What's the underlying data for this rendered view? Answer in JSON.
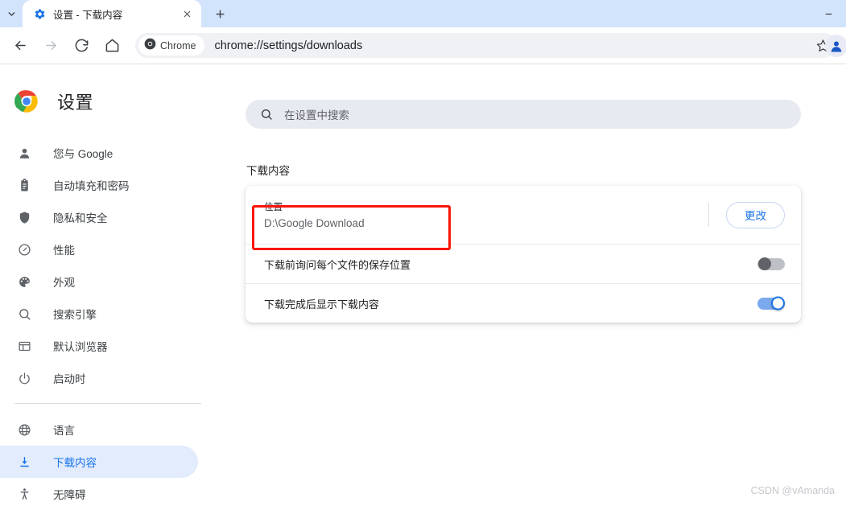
{
  "window": {
    "minimize_label": "−",
    "tab_list_icon": "chevron-down-icon"
  },
  "tab": {
    "favicon": "settings-gear-icon",
    "title": "设置 - 下载内容",
    "close_label": "✕",
    "newtab_label": "+"
  },
  "toolbar": {
    "back_icon": "back-arrow-icon",
    "forward_icon": "forward-arrow-icon",
    "reload_icon": "reload-icon",
    "home_icon": "home-icon",
    "chip_label": "Chrome",
    "url": "chrome://settings/downloads",
    "star_icon": "bookmark-star-icon",
    "profile_icon": "profile-avatar-icon"
  },
  "sidebar": {
    "brand_title": "设置",
    "brand_logo": "chrome-logo",
    "items": [
      {
        "label": "您与 Google",
        "icon": "person-icon",
        "selected": false
      },
      {
        "label": "自动填充和密码",
        "icon": "clipboard-icon",
        "selected": false
      },
      {
        "label": "隐私和安全",
        "icon": "shield-icon",
        "selected": false
      },
      {
        "label": "性能",
        "icon": "speedometer-icon",
        "selected": false
      },
      {
        "label": "外观",
        "icon": "palette-icon",
        "selected": false
      },
      {
        "label": "搜索引擎",
        "icon": "search-icon",
        "selected": false
      },
      {
        "label": "默认浏览器",
        "icon": "browser-window-icon",
        "selected": false
      },
      {
        "label": "启动时",
        "icon": "power-icon",
        "selected": false
      }
    ],
    "items2": [
      {
        "label": "语言",
        "icon": "globe-icon",
        "selected": false
      },
      {
        "label": "下载内容",
        "icon": "download-icon",
        "selected": true
      },
      {
        "label": "无障碍",
        "icon": "accessibility-icon",
        "selected": false
      }
    ]
  },
  "search": {
    "placeholder": "在设置中搜索",
    "icon": "search-icon"
  },
  "main": {
    "section_title": "下载内容",
    "location": {
      "label": "位置",
      "value": "D:\\Google Download",
      "change_button": "更改"
    },
    "ask_row": {
      "label": "下载前询问每个文件的保存位置",
      "state": "off"
    },
    "show_row": {
      "label": "下载完成后显示下载内容",
      "state": "on"
    }
  },
  "annotation": {
    "color": "#fa1607"
  },
  "watermark": {
    "text": "CSDN @vAmanda"
  }
}
